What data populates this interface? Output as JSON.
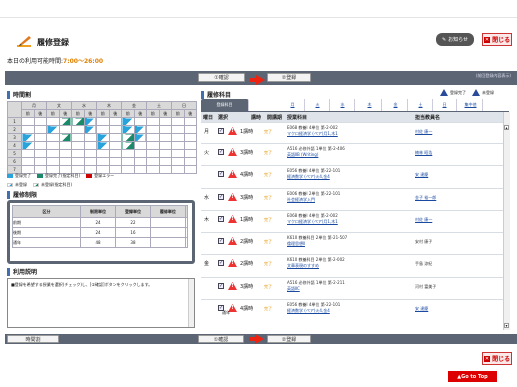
{
  "header": {
    "title": "履修登録",
    "notice_label": "お知らせ",
    "close_label": "閉じる",
    "time_prefix": "本日の利用可能時間:",
    "time_value": "7:00〜26:00"
  },
  "steps": {
    "confirm": "①確認",
    "register": "②登録",
    "previous_note": "(前回登録内容表示)"
  },
  "timetable": {
    "title": "時間割",
    "days": [
      "月",
      "文",
      "水",
      "木",
      "金",
      "土",
      "日"
    ],
    "sub": [
      "前",
      "後"
    ],
    "periods": [
      "1",
      "2",
      "3",
      "4",
      "5",
      "6",
      "7"
    ]
  },
  "legend": {
    "done": "登録完了",
    "fixed": "登録完了(指定科目)",
    "error": "登録エラー",
    "pending": "未登録",
    "pending_fixed": "未登録(指定科目)"
  },
  "limit": {
    "title": "履修制限",
    "headers": [
      "区分",
      "制限単位",
      "登録単位",
      "履修単位"
    ],
    "rows": [
      {
        "label": "前期",
        "a": "24",
        "b": "22"
      },
      {
        "label": "後期",
        "a": "24",
        "b": "16"
      },
      {
        "label": "通年",
        "a": "48",
        "b": "38"
      }
    ]
  },
  "usage": {
    "title": "利用説明",
    "text": "■登録を希望する授業を選択(チェック)し、[①確認]ボタンをクリックします。"
  },
  "subjects": {
    "title": "履修科目",
    "legend_done": "登録完了",
    "legend_pending": "未登録",
    "tabs": [
      "登録科目",
      "月",
      "火",
      "水",
      "木",
      "金",
      "土",
      "日",
      "集中他"
    ],
    "columns": [
      "曜日",
      "選択",
      "講時",
      "開講期",
      "授業科目",
      "担当教員名"
    ],
    "rows": [
      {
        "day": "月",
        "period": "1講時",
        "status": "完了",
        "l1": "E068 教養Ⅰ 4単位 第-2-002",
        "l2": "マクロ経済学 (ペア)月1,木1",
        "teacher": "村佐 康一",
        "link": true
      },
      {
        "day": "火",
        "period": "3講時",
        "status": "完了",
        "l1": "A516 必修外語 1単位 第-2-406",
        "l2": "英語ⅡB (Writing)",
        "teacher": "楠林 昭浩",
        "link": true
      },
      {
        "day": "",
        "period": "4講時",
        "status": "完了",
        "l1": "E056 教養Ⅰ 4単位 第-22-101",
        "l2": "経済数学 (ペア)火4,金4",
        "teacher": "安 達慶",
        "link": true
      },
      {
        "day": "水",
        "period": "3講時",
        "status": "完了",
        "l1": "E006 教養Ⅰ 2単位 第-22-101",
        "l2": "社会経済学入門",
        "teacher": "金子 裕一郎",
        "link": true
      },
      {
        "day": "木",
        "period": "1講時",
        "status": "完了",
        "l1": "E068 教養Ⅰ 4単位 第-2-002",
        "l2": "マクロ経済学 (ペア)月1,木1",
        "teacher": "村佐 康一",
        "link": true
      },
      {
        "day": "",
        "period": "2講時",
        "status": "完了",
        "l1": "K610 教養科目 2単位 第-21-507",
        "l2": "倫理思想Ⅱ",
        "teacher": "安村 康子",
        "link": false
      },
      {
        "day": "金",
        "period": "2講時",
        "status": "完了",
        "l1": "K610 教養科目 2単位 第-2-002",
        "l2": "文章表現のすすめ",
        "teacher": "手島 涼紀",
        "link": false
      },
      {
        "day": "",
        "period": "3講時",
        "status": "完了",
        "l1": "A516 必修外語 1単位 第-2-211",
        "l2": "英語ⅡC",
        "teacher": "河村 富美子",
        "link": false
      },
      {
        "day": "",
        "period": "4講時",
        "status": "完了",
        "l1": "E056 教養Ⅰ 4単位 第-22-101",
        "l2": "経済数学 (ペア)火4,金4",
        "teacher": "安 達慶",
        "link": true
      }
    ],
    "extra_label": "通年"
  },
  "footer": {
    "timetable_btn": "時間割",
    "go_top": "▲Go to Top"
  },
  "colors": {
    "bar": "#5b6573",
    "done_blue": "#29a3dc",
    "fixed_teal": "#1a8a6a",
    "error_red": "#d00000"
  }
}
